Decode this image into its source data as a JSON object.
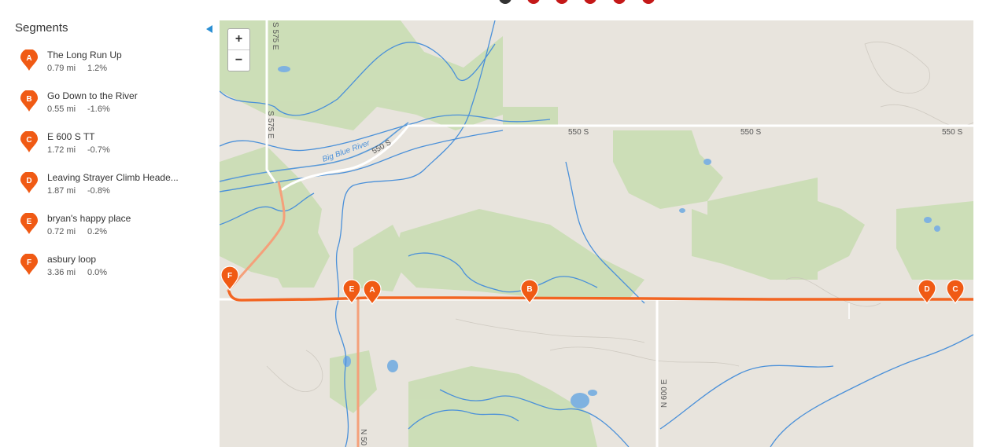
{
  "sidebar": {
    "title": "Segments",
    "segments": [
      {
        "letter": "A",
        "name": "The Long Run Up",
        "distance": "0.79 mi",
        "grade": "1.2%"
      },
      {
        "letter": "B",
        "name": "Go Down to the River",
        "distance": "0.55 mi",
        "grade": "-1.6%"
      },
      {
        "letter": "C",
        "name": "E 600 S TT",
        "distance": "1.72 mi",
        "grade": "-0.7%"
      },
      {
        "letter": "D",
        "name": "Leaving Strayer Climb Heade...",
        "distance": "1.87 mi",
        "grade": "-0.8%"
      },
      {
        "letter": "E",
        "name": "bryan's happy place",
        "distance": "0.72 mi",
        "grade": "0.2%"
      },
      {
        "letter": "F",
        "name": "asbury loop",
        "distance": "3.36 mi",
        "grade": "0.0%"
      }
    ]
  },
  "map": {
    "zoom_in_label": "+",
    "zoom_out_label": "−",
    "road_labels": {
      "s575e_top": "S 575 E",
      "s575e_mid": "S 575 E",
      "r550s_a": "550 S",
      "r550s_b": "550 S",
      "r550s_c": "550 S",
      "r550s_d": "550 S",
      "n600e": "N 600 E",
      "n50": "N 50",
      "river": "Big Blue River"
    },
    "markers": {
      "A": "A",
      "B": "B",
      "C": "C",
      "D": "D",
      "E": "E",
      "F": "F"
    }
  },
  "colors": {
    "pin": "#f05a14",
    "route": "#f26522",
    "route_light": "#f5a07a",
    "water": "#4a90d9",
    "water_fill": "#7fb2e0",
    "park": "#bcd9a7",
    "land": "#e8e4dd",
    "road": "#ffffff",
    "accent": "#2b8fd4"
  },
  "icons": {
    "collapse": "triangle-left-icon",
    "pin": "map-pin-icon"
  }
}
